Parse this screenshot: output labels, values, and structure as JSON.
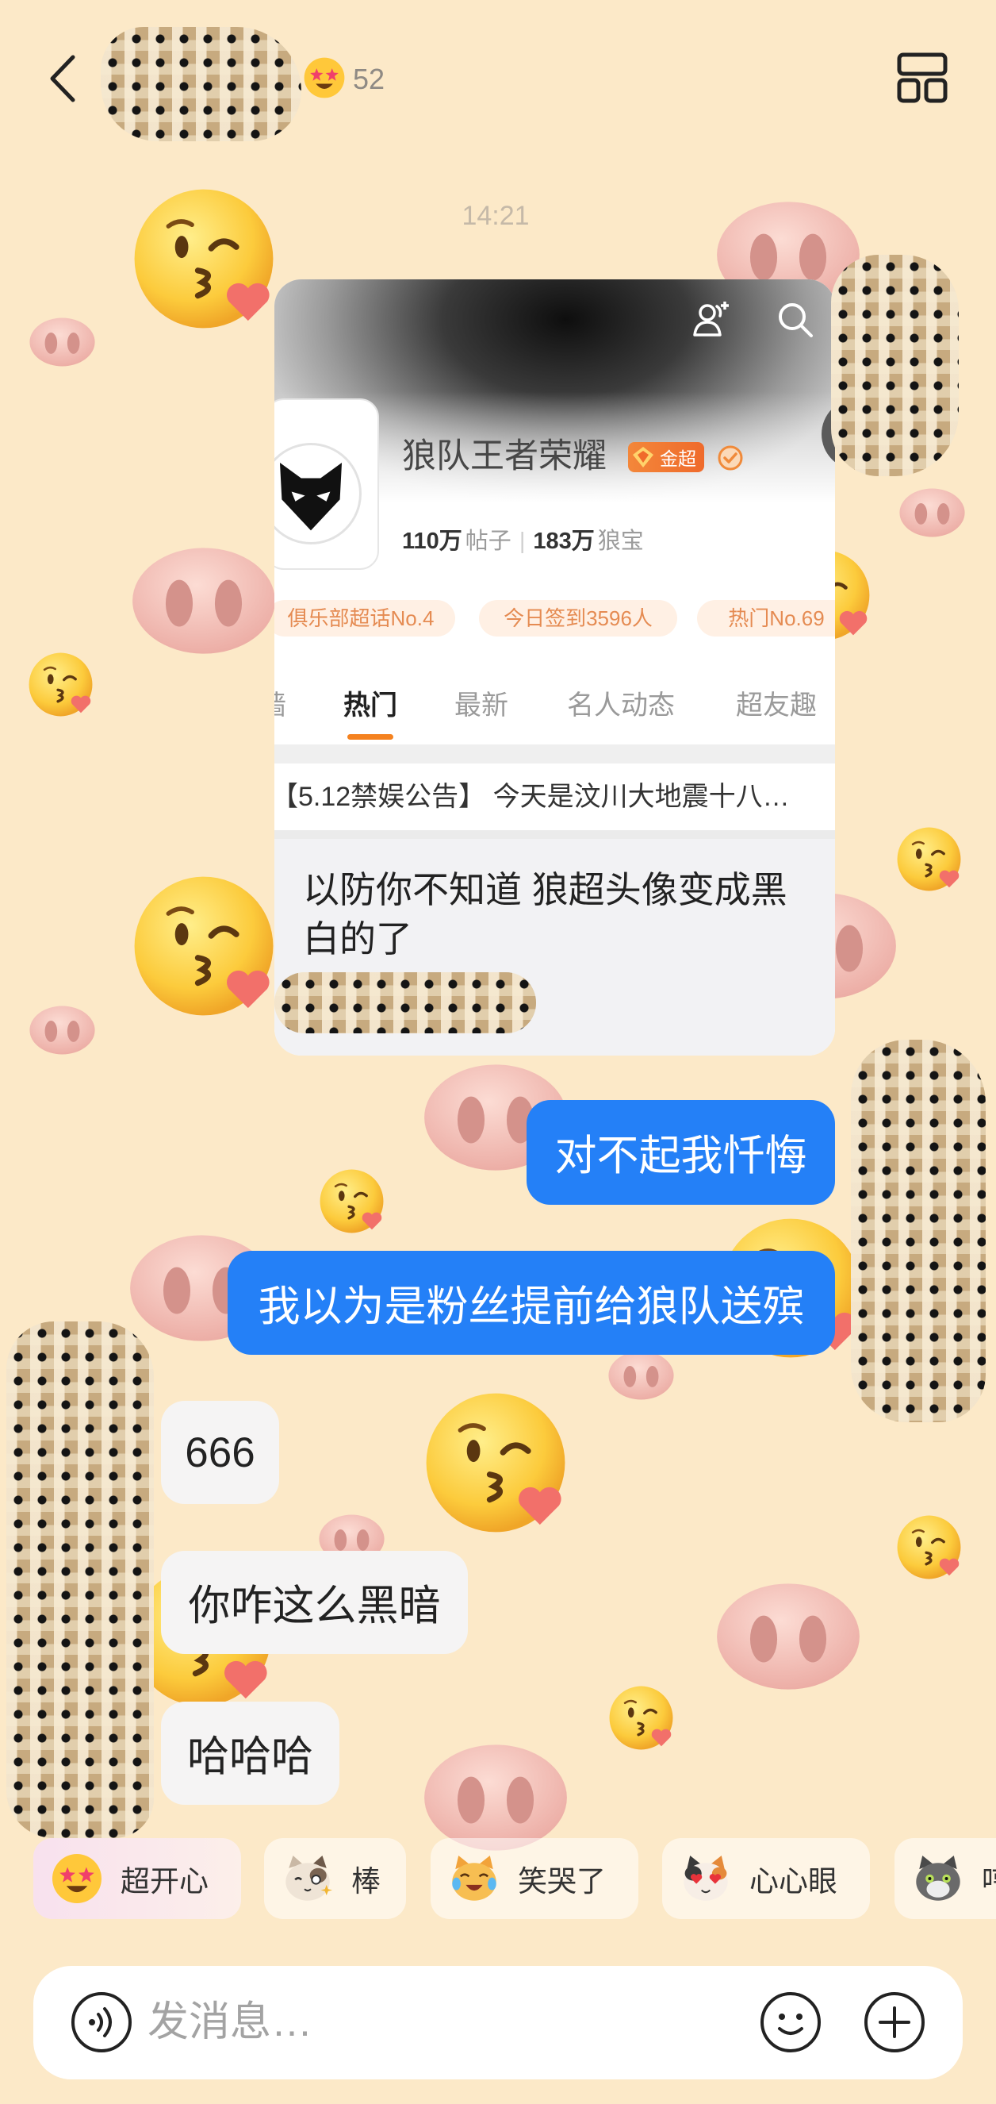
{
  "header": {
    "back_icon": "chevron-left-icon",
    "badge_icon": "star-struck-face-icon",
    "badge_count": "52",
    "layout_icon": "layout-grid-icon"
  },
  "timestamp": "14:21",
  "shared_card": {
    "add_friend_icon": "people-add-icon",
    "search_icon": "search-icon",
    "topic_title": "狼队王者荣耀",
    "level_badge": "金超",
    "stats": {
      "posts_value": "110万",
      "posts_label": "帖子",
      "fans_value": "183万",
      "fans_label": "狼宝"
    },
    "tags": [
      "俱乐部超话No.4",
      "今日签到3596人",
      "热门No.69"
    ],
    "tabs": [
      {
        "label": "墙",
        "active": false
      },
      {
        "label": "热门",
        "active": true
      },
      {
        "label": "最新",
        "active": false
      },
      {
        "label": "名人动态",
        "active": false
      },
      {
        "label": "超友趣",
        "active": false
      }
    ],
    "announcement": "【5.12禁娱公告】 今天是汶川大地震十八…",
    "message": "以防你不知道 狼超头像变成黑白的了"
  },
  "messages": [
    {
      "side": "sent",
      "text": "对不起我忏悔"
    },
    {
      "side": "sent",
      "text": "我以为是粉丝提前给狼队送殡"
    },
    {
      "side": "received",
      "text": "666"
    },
    {
      "side": "received",
      "text": "你咋这么黑暗"
    },
    {
      "side": "received",
      "text": "哈哈哈"
    }
  ],
  "quick_reactions": [
    {
      "icon": "star-struck-face-icon",
      "label": "超开心"
    },
    {
      "icon": "cat-sparkle-icon",
      "label": "棒"
    },
    {
      "icon": "cat-laughing-tears-icon",
      "label": "笑哭了"
    },
    {
      "icon": "cat-heart-eyes-icon",
      "label": "心心眼"
    },
    {
      "icon": "gray-cat-icon",
      "label": "哼"
    }
  ],
  "input": {
    "voice_icon": "voice-icon",
    "placeholder": "发消息…",
    "emoji_icon": "smile-icon",
    "plus_icon": "plus-circle-icon"
  },
  "colors": {
    "background": "#FCE9C8",
    "sent_bubble": "#2480F7",
    "received_bubble": "#F5F4F4",
    "accent_orange": "#F5821F"
  }
}
